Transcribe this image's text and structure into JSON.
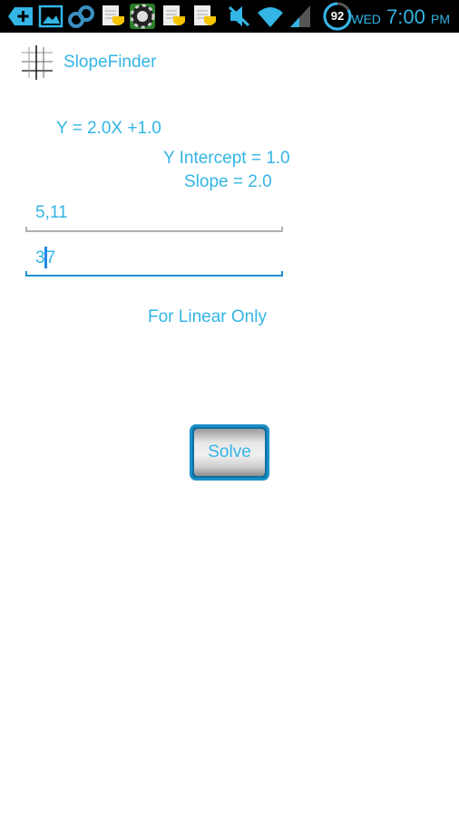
{
  "status_bar": {
    "notification_icons": [
      "add-icon",
      "image-icon",
      "binoculars-icon",
      "document-shield-icon",
      "poker-chip-icon",
      "document-shield-icon",
      "document-shield-icon"
    ],
    "system_icons": [
      "mute-icon",
      "wifi-icon",
      "signal-icon"
    ],
    "battery_level": "92",
    "day": "WED",
    "time": "7:00",
    "ampm": "PM"
  },
  "app": {
    "title": "SlopeFinder",
    "icon": "grid-graph-icon"
  },
  "results": {
    "equation": "Y = 2.0X +1.0",
    "y_intercept": "Y Intercept = 1.0",
    "slope": "Slope = 2.0"
  },
  "inputs": {
    "point1": "5,11",
    "point2_before_cursor": "3",
    "point2_after_cursor": "7"
  },
  "note": "For Linear Only",
  "solve_button": "Solve",
  "colors": {
    "accent": "#33b5e5",
    "statusbar": "#000000",
    "active_underline": "#1f8fd0"
  }
}
